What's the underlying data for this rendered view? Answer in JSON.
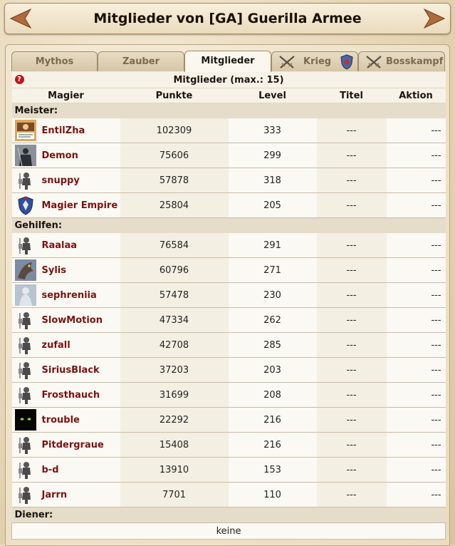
{
  "header": {
    "title": "Mitglieder von [GA] Guerilla Armee"
  },
  "tabs": [
    {
      "label": "Mythos"
    },
    {
      "label": "Zauber"
    },
    {
      "label": "Mitglieder"
    },
    {
      "label": "Krieg"
    },
    {
      "label": "Bosskampf"
    }
  ],
  "table": {
    "caption": "Mitglieder (max.: 15)",
    "columns": [
      "Magier",
      "Punkte",
      "Level",
      "Titel",
      "Aktion"
    ],
    "groups": [
      {
        "label": "Meister:",
        "members": [
          {
            "name": "EntilZha",
            "points": "102309",
            "level": "333",
            "title": "---",
            "action": "---",
            "avatar": "photo"
          },
          {
            "name": "Demon",
            "points": "75606",
            "level": "299",
            "title": "---",
            "action": "---",
            "avatar": "dark-figure"
          },
          {
            "name": "snuppy",
            "points": "57878",
            "level": "318",
            "title": "---",
            "action": "---",
            "avatar": "warrior"
          },
          {
            "name": "Magier Empire",
            "points": "25804",
            "level": "205",
            "title": "---",
            "action": "---",
            "avatar": "crest"
          }
        ]
      },
      {
        "label": "Gehilfen:",
        "members": [
          {
            "name": "Raalaa",
            "points": "76584",
            "level": "291",
            "title": "---",
            "action": "---",
            "avatar": "warrior"
          },
          {
            "name": "Sylis",
            "points": "60796",
            "level": "271",
            "title": "---",
            "action": "---",
            "avatar": "dragon"
          },
          {
            "name": "sephreniia",
            "points": "57478",
            "level": "230",
            "title": "---",
            "action": "---",
            "avatar": "pale-figure"
          },
          {
            "name": "SlowMotion",
            "points": "47334",
            "level": "262",
            "title": "---",
            "action": "---",
            "avatar": "warrior"
          },
          {
            "name": "zufall",
            "points": "42708",
            "level": "285",
            "title": "---",
            "action": "---",
            "avatar": "warrior"
          },
          {
            "name": "SiriusBlack",
            "points": "37203",
            "level": "203",
            "title": "---",
            "action": "---",
            "avatar": "warrior"
          },
          {
            "name": "Frosthauch",
            "points": "31699",
            "level": "208",
            "title": "---",
            "action": "---",
            "avatar": "warrior"
          },
          {
            "name": "trouble",
            "points": "22292",
            "level": "216",
            "title": "---",
            "action": "---",
            "avatar": "black-eyes"
          },
          {
            "name": "Pitdergraue",
            "points": "15408",
            "level": "216",
            "title": "---",
            "action": "---",
            "avatar": "warrior"
          },
          {
            "name": "b-d",
            "points": "13910",
            "level": "153",
            "title": "---",
            "action": "---",
            "avatar": "warrior"
          },
          {
            "name": "Jarrn",
            "points": "7701",
            "level": "110",
            "title": "---",
            "action": "---",
            "avatar": "warrior"
          }
        ]
      },
      {
        "label": "Diener:",
        "members": []
      }
    ],
    "empty_text": "keine"
  },
  "colors": {
    "name_link": "#7a1212",
    "group_bg": "#e6dcca",
    "help_icon": "#c0141b"
  }
}
